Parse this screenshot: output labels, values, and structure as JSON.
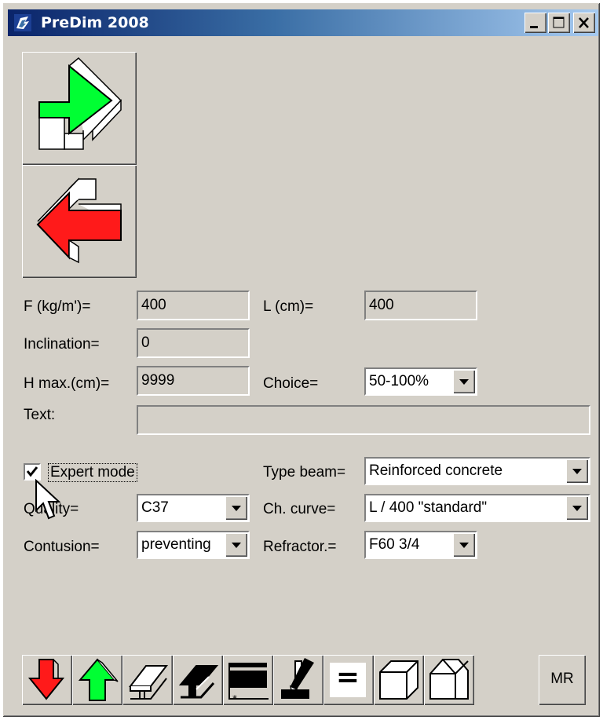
{
  "window": {
    "title": "PreDim 2008"
  },
  "fields": {
    "f_label": "F (kg/m')=",
    "f_value": "400",
    "l_label": "L (cm)=",
    "l_value": "400",
    "inclination_label": "Inclination=",
    "inclination_value": "0",
    "hmax_label": "H max.(cm)=",
    "hmax_value": "9999",
    "choice_label": "Choice=",
    "choice_value": "50-100%",
    "text_label": "Text:",
    "text_value": ""
  },
  "expert": {
    "checkbox_label": "Expert mode",
    "checked": true,
    "type_beam_label": "Type beam=",
    "type_beam_value": "Reinforced concrete",
    "quality_label": "Quality=",
    "quality_value": "C37",
    "ch_curve_label": "Ch. curve=",
    "ch_curve_value": "L / 400 \"standard\"",
    "contusion_label": "Contusion=",
    "contusion_value": "preventing",
    "refractor_label": "Refractor.=",
    "refractor_value": "F60 3/4"
  },
  "toolbar": {
    "equals_label": "=",
    "mr_label": "MR",
    "icons": [
      "red-down-arrow-icon",
      "green-up-arrow-icon",
      "i-beam-outline-icon",
      "i-beam-filled-icon",
      "section-profile-icon",
      "pencil-section-icon",
      "equals-icon",
      "box-icon",
      "house-box-icon"
    ]
  },
  "colors": {
    "titlebar_start": "#0a246a",
    "titlebar_end": "#a6caf0",
    "face": "#d4d0c8",
    "green_arrow": "#00ff33",
    "red_arrow": "#ff1a1a"
  }
}
